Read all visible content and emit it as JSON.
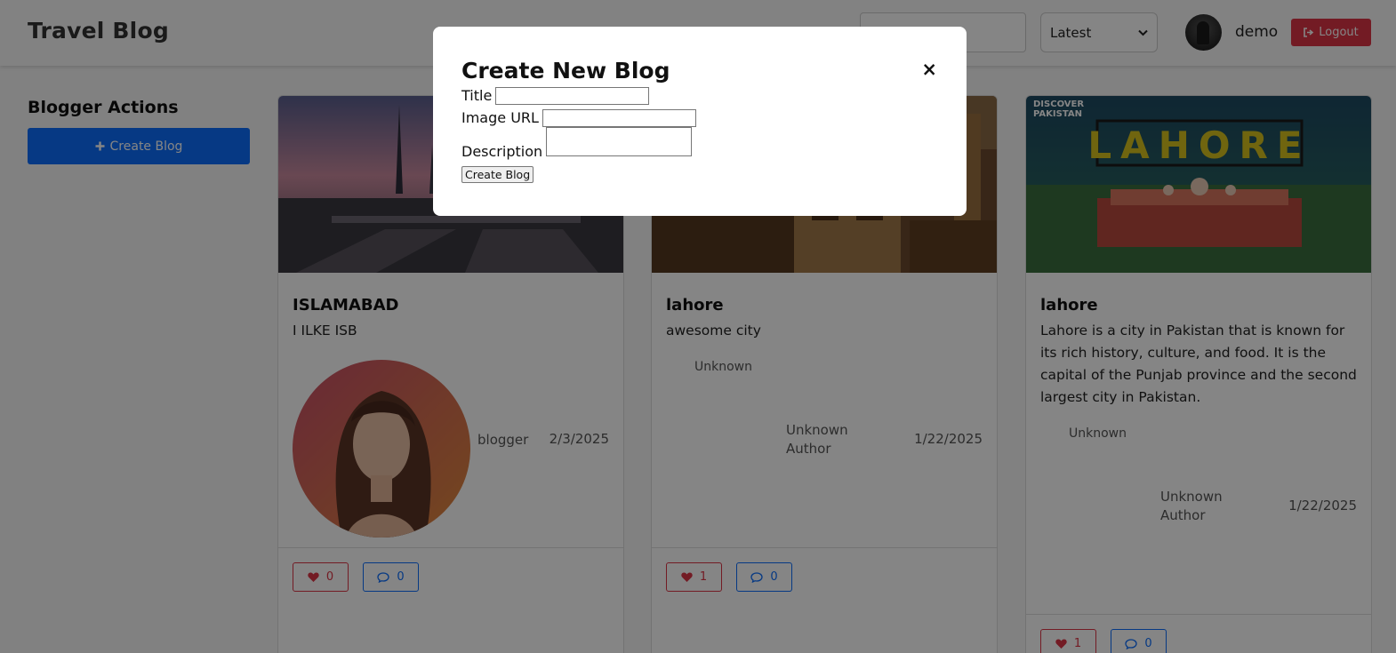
{
  "header": {
    "brand": "Travel Blog",
    "search": {
      "placeholder": ""
    },
    "sort": {
      "selected": "Latest"
    },
    "user": {
      "name": "demo"
    },
    "logout_label": "Logout"
  },
  "sidebar": {
    "title": "Blogger Actions",
    "create_label": "Create Blog"
  },
  "posts": [
    {
      "title": "ISLAMABAD",
      "description": "I ILKE ISB",
      "author": "blogger",
      "date": "2/3/2025",
      "likes": "0",
      "comments": "0"
    },
    {
      "title": "lahore",
      "description": "awesome city",
      "author_alt": "Unknown",
      "author": "Unknown Author",
      "date": "1/22/2025",
      "likes": "1",
      "comments": "0"
    },
    {
      "title": "lahore",
      "description": "Lahore is a city in Pakistan that is known for its rich history, culture, and food. It is the capital of the Punjab province and the second largest city in Pakistan.",
      "image_text": {
        "badge_top": "DISCOVER",
        "badge_bottom": "PAKISTAN",
        "city": "LAHORE"
      },
      "author_alt": "Unknown",
      "author": "Unknown Author",
      "date": "1/22/2025",
      "likes": "1",
      "comments": "0"
    }
  ],
  "modal": {
    "title": "Create New Blog",
    "close": "×",
    "fields": {
      "title_label": "Title",
      "title_value": "",
      "image_label": "Image URL",
      "image_value": "",
      "description_label": "Description",
      "description_value": ""
    },
    "submit_label": "Create Blog"
  },
  "colors": {
    "danger": "#dc3545",
    "primary": "#0d6efd"
  },
  "icons": [
    "sign-out-icon",
    "plus-icon",
    "heart-icon",
    "comment-icon",
    "close-icon",
    "chevron-down-icon"
  ]
}
